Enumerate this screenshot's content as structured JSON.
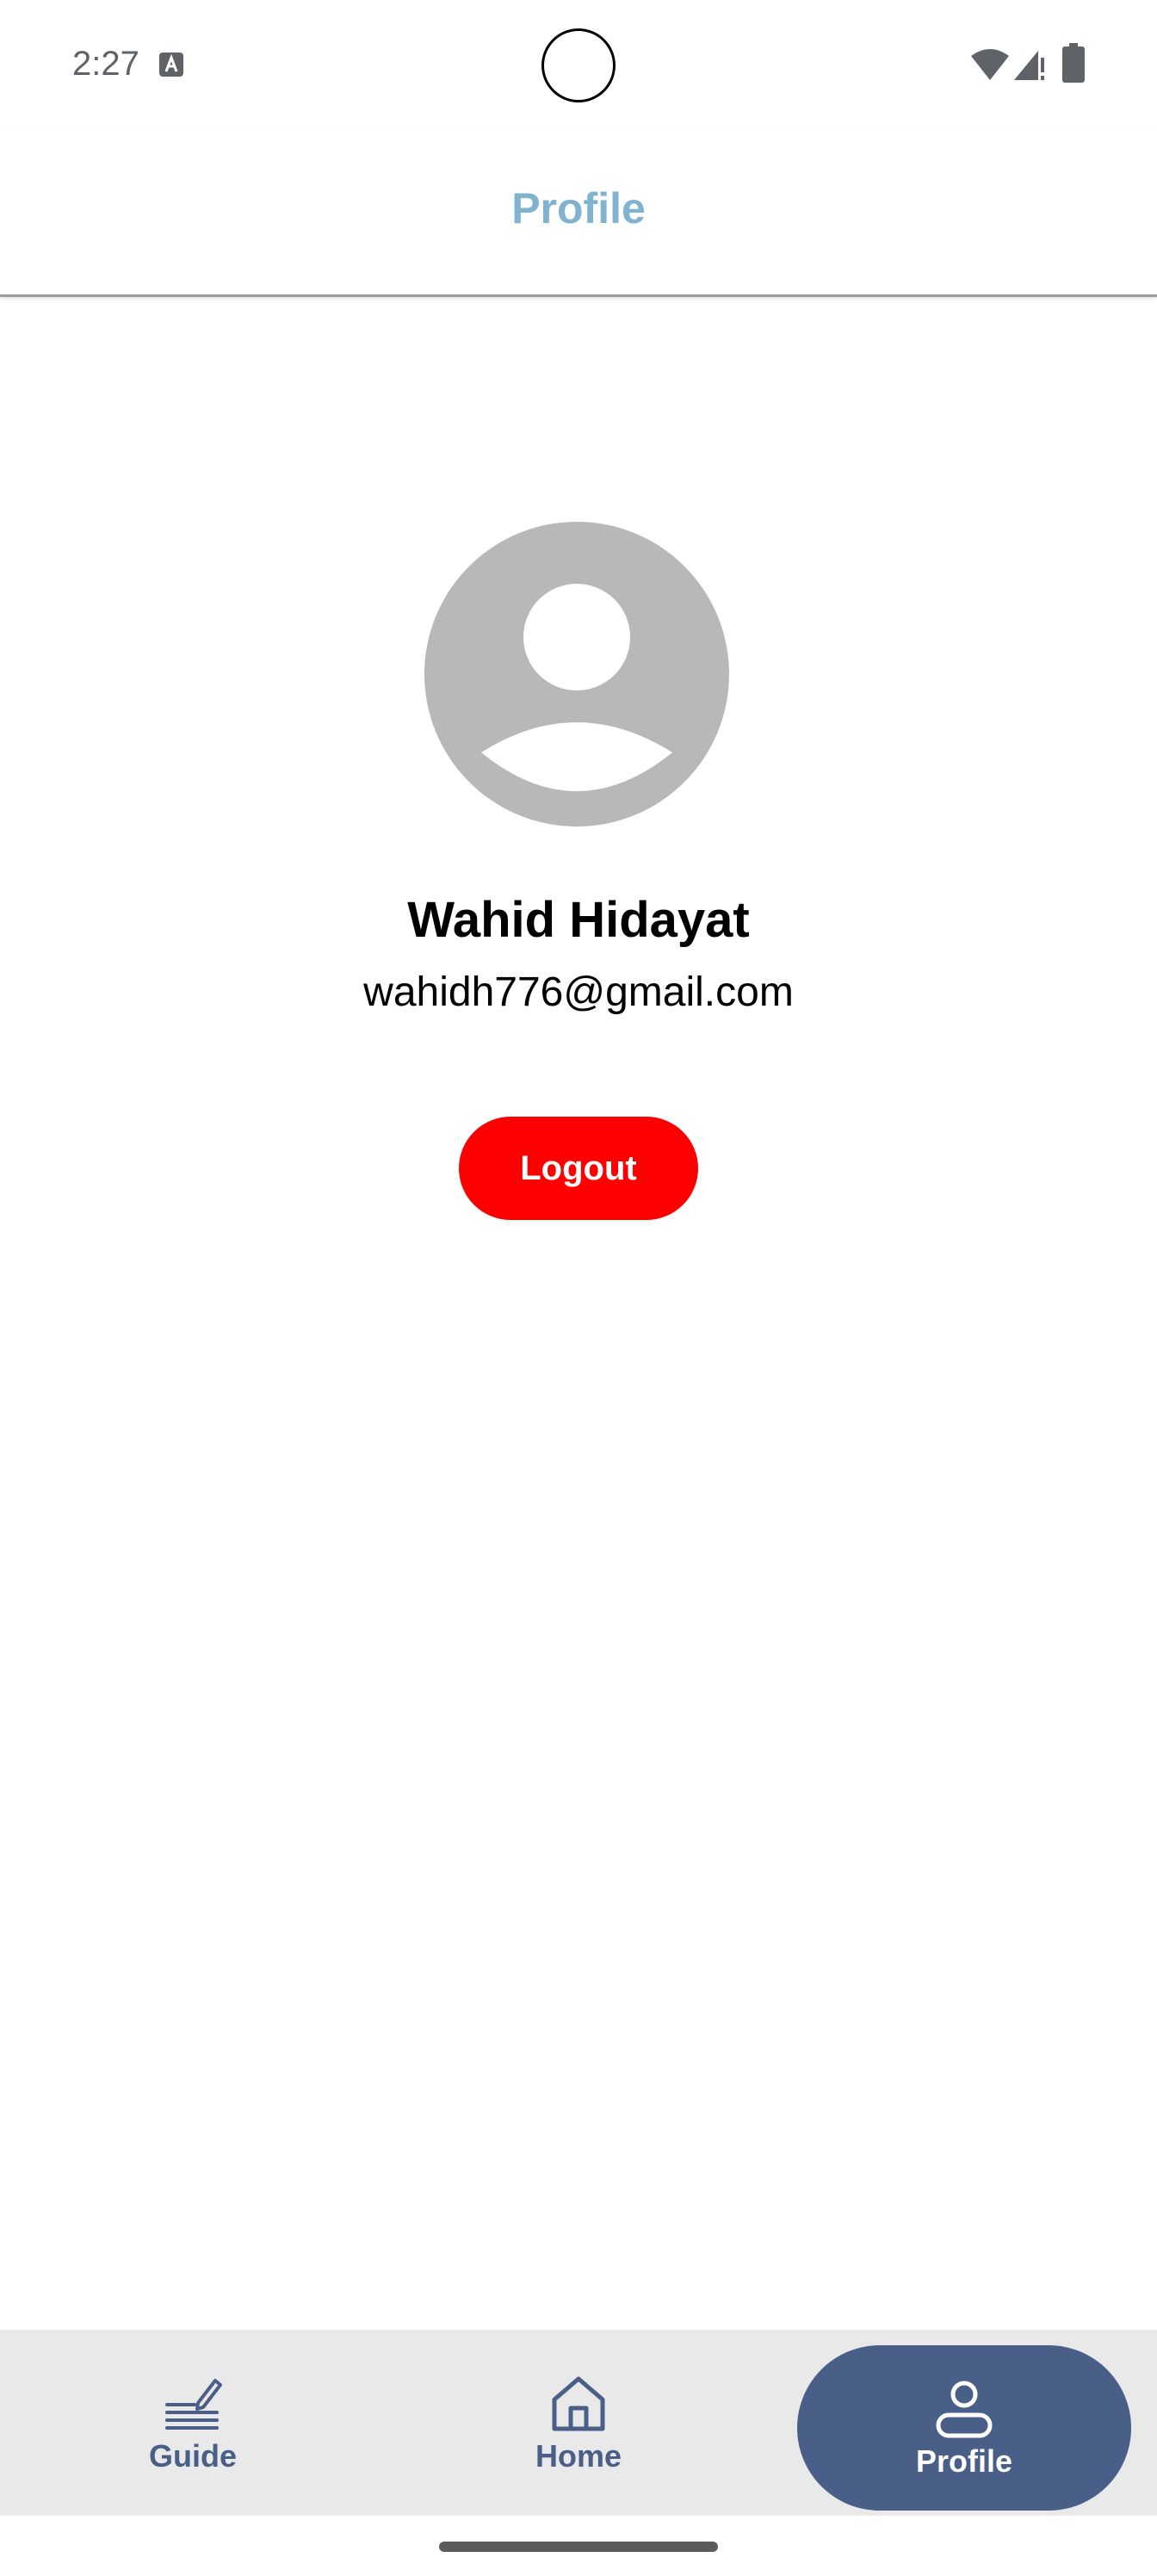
{
  "status_bar": {
    "time": "2:27",
    "icons": [
      "keyboard-a-icon",
      "wifi-icon",
      "signal-icon",
      "battery-icon"
    ]
  },
  "app_bar": {
    "title": "Profile",
    "title_color": "#7fb3cf"
  },
  "profile": {
    "avatar_icon": "default-avatar-icon",
    "name": "Wahid Hidayat",
    "email": "wahidh776@gmail.com",
    "logout_label": "Logout",
    "logout_color": "#ff0000"
  },
  "bottom_nav": {
    "active_color": "#4a5f88",
    "items": [
      {
        "label": "Guide",
        "icon": "guide-edit-icon",
        "active": false
      },
      {
        "label": "Home",
        "icon": "home-icon",
        "active": false
      },
      {
        "label": "Profile",
        "icon": "person-icon",
        "active": true
      }
    ]
  }
}
